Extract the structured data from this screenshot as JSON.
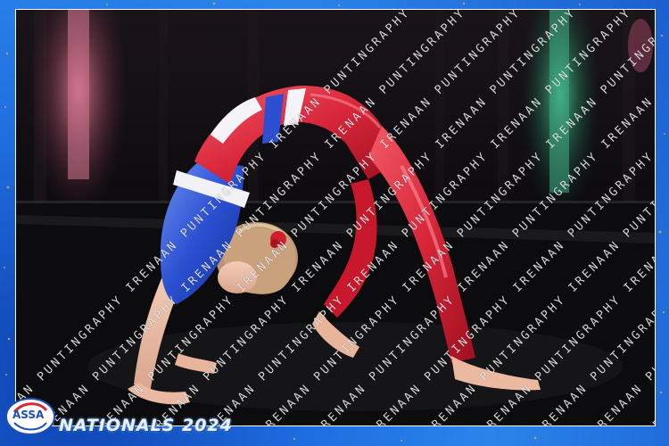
{
  "photo": {
    "watermark_text": "IRENAAN PUNTINGRAPHY",
    "event_title": "NATIONALS 2024",
    "logo_text": "ASSA"
  }
}
